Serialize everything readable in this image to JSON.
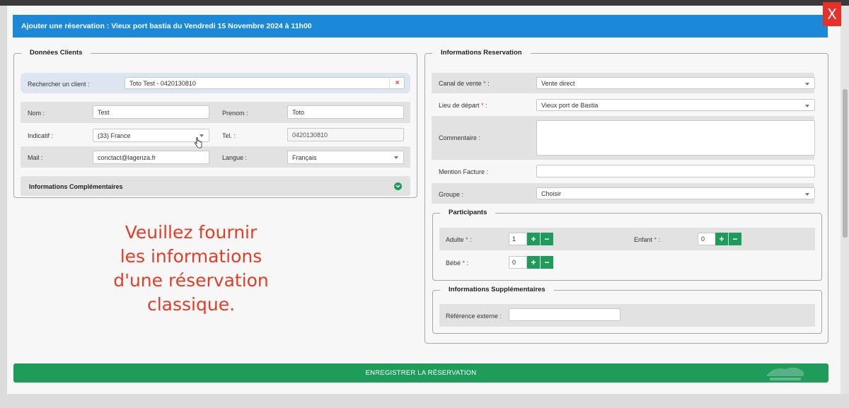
{
  "modal": {
    "title": "Ajouter une réservation : Vieux port bastia du Vendredi 15 Novembre 2024 à 11h00",
    "close_label": "X"
  },
  "client": {
    "legend": "Données Clients",
    "search_label": "Rechercher un client :",
    "search_value": "Toto Test - 0420130810",
    "clear_icon": "×",
    "nom_label": "Nom :",
    "nom_value": "Test",
    "prenom_label": "Prenom :",
    "prenom_value": "Toto",
    "indicatif_label": "Indicatif :",
    "indicatif_value": "(33) France",
    "tel_label": "Tel. :",
    "tel_value": "0420130810",
    "mail_label": "Mail :",
    "mail_value": "conctact@lagenza.fr",
    "langue_label": "Langue :",
    "langue_value": "Français",
    "complementary_label": "Informations Complémentaires",
    "complementary_icon": "chevron-down-circle-icon"
  },
  "overlay_text": {
    "line1": "Veuillez fournir",
    "line2": "les informations",
    "line3": "d'une réservation",
    "line4": "classique."
  },
  "reservation": {
    "legend": "Informations Reservation",
    "canal_label": "Canal de vente",
    "canal_value": "Vente direct",
    "lieu_label": "Lieu de départ",
    "lieu_value": "Vieux port de Bastia",
    "commentaire_label": "Commentaire :",
    "mention_label": "Mention Facture :",
    "groupe_label": "Groupe :",
    "groupe_value": "Choisir",
    "required_mark": "*",
    "colon": " :"
  },
  "participants": {
    "legend": "Participants",
    "adulte_label": "Adulte",
    "adulte_value": "1",
    "enfant_label": "Enfant",
    "enfant_value": "0",
    "bebe_label": "Bébé",
    "bebe_value": "0",
    "plus": "+",
    "minus": "−"
  },
  "supplementary": {
    "legend": "Informations Supplémentaires",
    "ref_label": "Référence externe :",
    "ref_value": ""
  },
  "footer": {
    "save_label": "ENREGISTRER LA RÉSERVATION"
  },
  "colors": {
    "title_bar": "#1b88d8",
    "accent_green": "#1f9c5a",
    "close_red": "#e8302a",
    "overlay_red": "#e43d24"
  }
}
